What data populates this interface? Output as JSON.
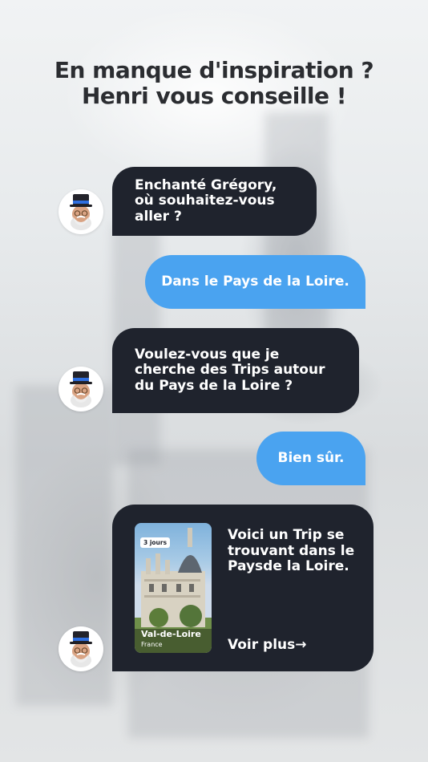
{
  "heading": {
    "line1": "En manque d'inspiration ?",
    "line2": "Henri vous conseille !"
  },
  "messages": [
    {
      "from": "henri",
      "text": "Enchanté Grégory, où souhaitez-vous aller ?"
    },
    {
      "from": "user",
      "text": "Dans le Pays de la Loire."
    },
    {
      "from": "henri",
      "text": "Voulez-vous que je cherche des Trips autour du Pays de la Loire ?"
    },
    {
      "from": "user",
      "text": "Bien sûr."
    },
    {
      "from": "henri",
      "text": "Voici un Trip se trouvant dans le Paysde la Loire."
    }
  ],
  "trip_card": {
    "duration": "3 jours",
    "place": "Val-de-Loire",
    "country": "France"
  },
  "more_link": "Voir plus→",
  "colors": {
    "henri_bubble": "#1f232d",
    "user_bubble": "#4aa3f0",
    "heading": "#2b2d31"
  },
  "icons": {
    "avatar": "henri-avatar-icon",
    "arrow": "arrow-right-icon"
  }
}
